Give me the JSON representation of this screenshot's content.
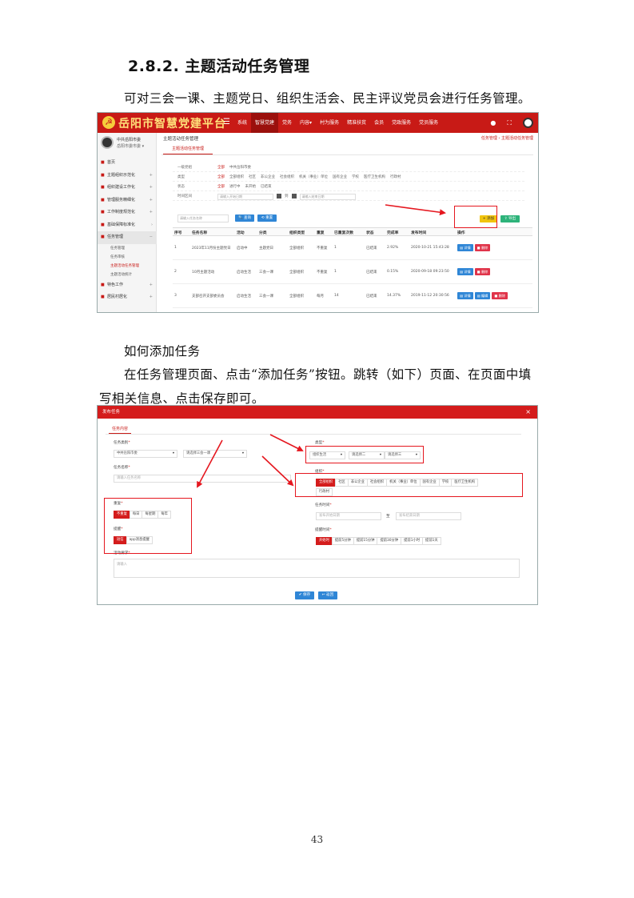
{
  "document": {
    "section_heading": "2.8.2.  主题活动任务管理",
    "intro": "可对三会一课、主题党日、组织生活会、民主评议党员会进行任务管理。",
    "how_to_title": "如何添加任务",
    "instructions_line1": "在任务管理页面、点击“添加任务”按钮。跳转（如下）页面、在页面中填",
    "instructions_line2": "写相关信息、点击保存即可。",
    "page_number": "43"
  },
  "screenshot1": {
    "header": {
      "logo_text": "岳阳市智慧党建平台",
      "menu_icon": "menu-icon",
      "nav_items": [
        "系统",
        "智慧党建",
        "党务",
        "内容▾",
        "村为服务",
        "精准扶贫",
        "会员",
        "党政服务",
        "党员服务"
      ],
      "active_nav": 1,
      "right_icons": [
        "bell-icon",
        "expand-icon",
        "avatar-icon"
      ]
    },
    "sidebar": {
      "user_name": "中共岳阳市委",
      "user_org": "岳阳市委市委 ▾",
      "items": [
        {
          "label": "首页",
          "icon": "home-icon",
          "arrow": ""
        },
        {
          "label": "主题组织示范化",
          "icon": "org-icon",
          "arrow": "+"
        },
        {
          "label": "组织建设工作化",
          "icon": "flag-icon",
          "arrow": "+"
        },
        {
          "label": "管理服务精细化",
          "icon": "grid-icon",
          "arrow": "+"
        },
        {
          "label": "工作制度规范化",
          "icon": "doc-icon",
          "arrow": "+"
        },
        {
          "label": "基础保障标准化",
          "icon": "shield-icon",
          "arrow": "›"
        },
        {
          "label": "任务管理",
          "icon": "task-icon",
          "arrow": "−"
        }
      ],
      "sub_items": [
        "任务管理",
        "任务审核",
        "主题活动任务管理",
        "主题活动统计"
      ],
      "active_sub": 2,
      "items_after": [
        {
          "label": "特色工作",
          "icon": "star-icon",
          "arrow": "+"
        },
        {
          "label": "居民村居化",
          "icon": "house-icon",
          "arrow": "+"
        }
      ]
    },
    "content": {
      "title": "主题活动任务管理",
      "breadcrumb": "任务管理 ›  主题活动任务管理",
      "tab": "主题活动任务管理",
      "filters": [
        {
          "label": "一级党组",
          "options": [
            "全部",
            "中共岳阳市委"
          ],
          "selected": 0
        },
        {
          "label": "类型",
          "options": [
            "全部",
            "全部组织",
            "社区",
            "非公企业",
            "社会组织",
            "机关（事业）单位",
            "国有企业",
            "学校",
            "医疗卫生机构",
            "行政村"
          ],
          "selected": 0
        },
        {
          "label": "状态",
          "options": [
            "全部",
            "进行中",
            "未开始",
            "已结束"
          ],
          "selected": 0
        }
      ],
      "date_filter": {
        "label": "时间区间",
        "start_placeholder": "请输入开始日期",
        "to": "到",
        "end_placeholder": "请输入结束日期"
      },
      "search_placeholder": "请输入任务名称",
      "search_button": "🔍 查询",
      "reset_button": "⟲ 重置",
      "add_button": "+ 添加",
      "export_button": "⇪ 导出",
      "columns": [
        "序号",
        "任务名称",
        "活动",
        "分类",
        "组织类型",
        "重复",
        "已重复次数",
        "状态",
        "完成率",
        "发布时间",
        "操作"
      ],
      "rows": [
        [
          "1",
          "2023年11月份主题党日",
          "启动中",
          "主题党日",
          "全部组织",
          "不重复",
          "1",
          "已结束",
          "2.92%",
          "2020-10-21 15:43:28"
        ],
        [
          "2",
          "10月主题活动",
          "启动生活",
          "三会一课",
          "全部组织",
          "不重复",
          "1",
          "已结束",
          "0.15%",
          "2020-09-18 09:23:50"
        ],
        [
          "3",
          "支部召开支部委员会",
          "启动生活",
          "三会一课",
          "全部组织",
          "每月",
          "14",
          "已结束",
          "14.37%",
          "2019-11-12 20:30:56"
        ]
      ],
      "row_actions": [
        [
          "详情",
          "删除"
        ],
        [
          "详情",
          "删除"
        ],
        [
          "详情",
          "编辑",
          "删除"
        ]
      ]
    }
  },
  "screenshot2": {
    "dialog_title": "发布任务",
    "close": "×",
    "tab": "任务内容",
    "fields": {
      "task_category_label": "任务类别",
      "category_value": "中共岳阳市委",
      "category_placeholder": "请选择三会一课",
      "task_name_label": "任务名称",
      "task_name_placeholder": "请输入任务名称",
      "type_label": "类型",
      "type_selects": [
        "组织生活",
        "请选择二",
        "请选择三"
      ],
      "org_label": "组织",
      "org_options": [
        "全部组织",
        "社区",
        "非公企业",
        "社会组织",
        "机关（事业）单位",
        "国有企业",
        "学校",
        "医疗卫生机构",
        "行政村"
      ],
      "org_selected": 0,
      "repeat_label": "重复",
      "repeat_options": [
        "不重复",
        "每日",
        "每星期",
        "每年"
      ],
      "repeat_selected": 0,
      "remind_label": "提醒",
      "remind_options": [
        "短信",
        "app消息提醒"
      ],
      "remind_selected": 0,
      "task_time_label": "任务时间",
      "start_placeholder": "发布开始日期",
      "to": "至",
      "end_placeholder": "发布结束日期",
      "remind_time_label": "提醒时间",
      "remind_time_options": [
        "开始时",
        "提前5分钟",
        "提前15分钟",
        "提前30分钟",
        "提前1小时",
        "提前1天"
      ],
      "remind_time_selected": 0,
      "desc_label": "活动要求",
      "desc_placeholder": "请输入"
    },
    "save_button": "✔ 保存",
    "back_button": "↩ 返回"
  },
  "colors": {
    "brand_red": "#c81a16",
    "annotation_red": "#e5171f",
    "primary_blue": "#2f86d6",
    "add_yellow": "#f1c40f",
    "export_green": "#2db37a",
    "delete_red": "#e0344a"
  }
}
